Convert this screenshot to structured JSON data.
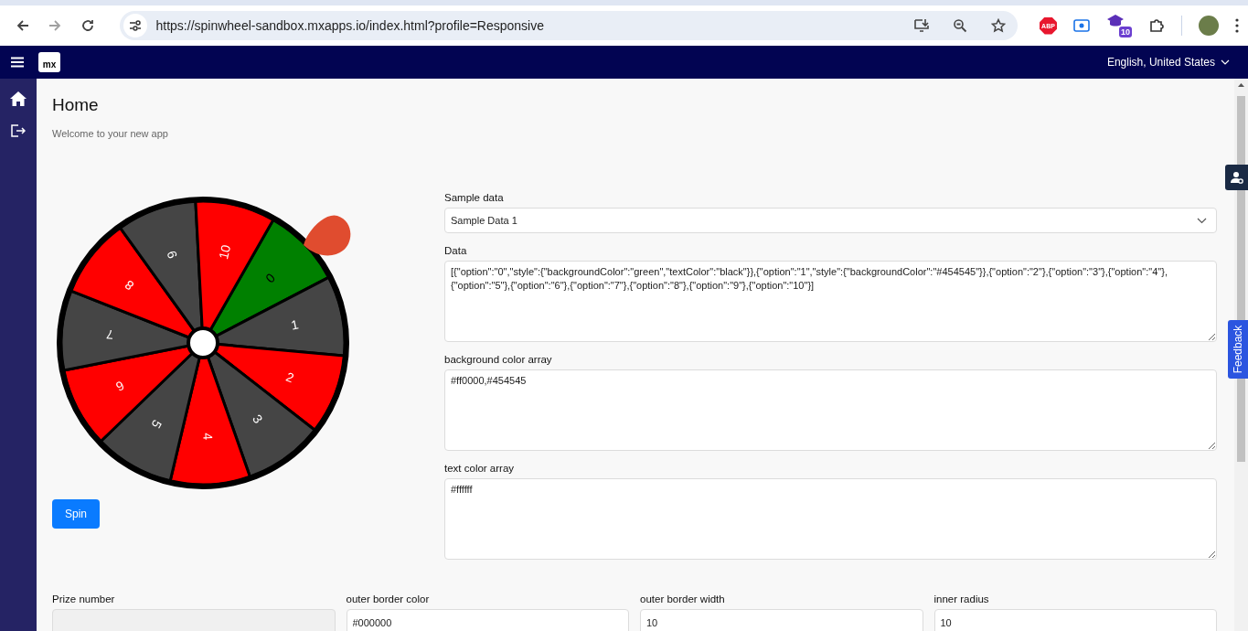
{
  "browser": {
    "url": "https://spinwheel-sandbox.mxapps.io/index.html?profile=Responsive",
    "back_disabled": false,
    "forward_disabled": true,
    "extensions": [
      {
        "kind": "abp",
        "label": "ABP"
      },
      {
        "kind": "screen"
      },
      {
        "kind": "cap",
        "badge": "10"
      },
      {
        "kind": "puzzle"
      }
    ]
  },
  "app_header": {
    "logo": "mx",
    "language": "English, United States"
  },
  "page": {
    "title": "Home",
    "subtitle": "Welcome to your new app"
  },
  "wheel": {
    "segments": [
      {
        "option": "0",
        "color": "#008000",
        "dark_text": true
      },
      {
        "option": "1",
        "color": "#454545",
        "dark_text": false
      },
      {
        "option": "2",
        "color": "#ff0000",
        "dark_text": false
      },
      {
        "option": "3",
        "color": "#454545",
        "dark_text": false
      },
      {
        "option": "4",
        "color": "#ff0000",
        "dark_text": false
      },
      {
        "option": "5",
        "color": "#454545",
        "dark_text": false
      },
      {
        "option": "6",
        "color": "#ff0000",
        "dark_text": false
      },
      {
        "option": "7",
        "color": "#454545",
        "dark_text": false
      },
      {
        "option": "8",
        "color": "#ff0000",
        "dark_text": false
      },
      {
        "option": "9",
        "color": "#454545",
        "dark_text": false
      },
      {
        "option": "10",
        "color": "#ff0000",
        "dark_text": false
      }
    ],
    "spin_button": "Spin"
  },
  "settings": [
    {
      "kind": "select",
      "label": "Sample data",
      "value": "Sample Data 1"
    },
    {
      "kind": "textarea",
      "label": "Data",
      "value": "[{\"option\":\"0\",\"style\":{\"backgroundColor\":\"green\",\"textColor\":\"black\"}},{\"option\":\"1\",\"style\":{\"backgroundColor\":\"#454545\"}},{\"option\":\"2\"},{\"option\":\"3\"},{\"option\":\"4\"},{\"option\":\"5\"},{\"option\":\"6\"},{\"option\":\"7\"},{\"option\":\"8\"},{\"option\":\"9\"},{\"option\":\"10\"}]"
    },
    {
      "kind": "textarea",
      "label": "background color array",
      "value": "#ff0000,#454545"
    },
    {
      "kind": "textarea",
      "label": "text color array",
      "value": "#ffffff"
    }
  ],
  "bottom_fields": [
    {
      "label": "Prize number",
      "disabled": true
    },
    {
      "label": "outer border color",
      "value": "#000000",
      "disabled": false
    },
    {
      "label": "outer border width",
      "value": "10",
      "disabled": false
    },
    {
      "label": "inner radius",
      "value": "10",
      "disabled": false
    }
  ],
  "feedback_tab": "Feedback"
}
